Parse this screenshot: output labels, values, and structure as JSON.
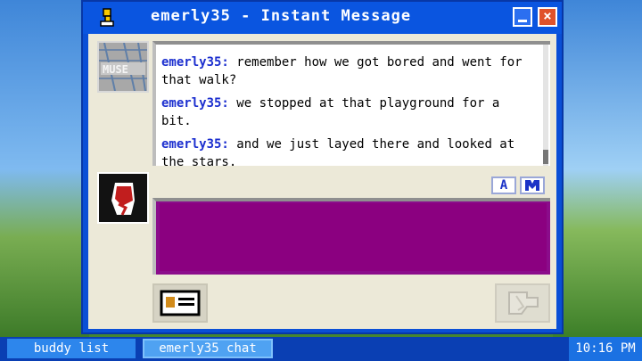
{
  "window": {
    "title": "emerly35 - Instant Message",
    "title_icon": "aim-running-man-icon"
  },
  "avatars": {
    "top_text": "MUSE",
    "top_icon": "muse-avatar",
    "bottom_icon": "fist-avatar"
  },
  "conversation": {
    "messages": [
      {
        "sender": "emerly35:",
        "text": "remember how we got bored and went for that walk?"
      },
      {
        "sender": "emerly35:",
        "text": "we stopped at that playground for a bit."
      },
      {
        "sender": "emerly35:",
        "text": "and we just layed there and looked at the stars."
      }
    ]
  },
  "format": {
    "font_button_label": "A",
    "style_button_icon": "font-style-icon"
  },
  "input": {
    "value": "",
    "background_color": "#8b0080"
  },
  "actions": {
    "profile_icon": "profile-card-icon",
    "send_icon": "send-hand-icon"
  },
  "taskbar": {
    "buddy_list": "buddy list",
    "chat": "emerly35 chat",
    "clock": "10:16 PM"
  },
  "colors": {
    "titlebar": "#0a55e0",
    "sender": "#1c2fcf",
    "taskbar": "#0a3fb3"
  }
}
